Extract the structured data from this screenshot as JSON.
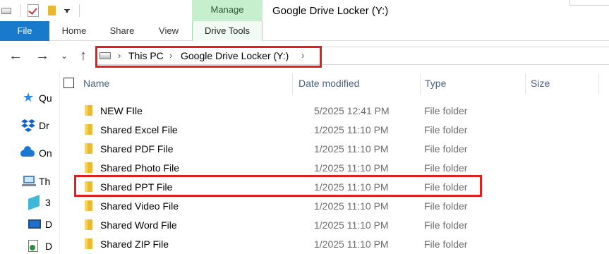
{
  "window": {
    "title": "Google Drive Locker (Y:)",
    "contextual_tab_group": "Manage"
  },
  "ribbon": {
    "tabs": [
      "File",
      "Home",
      "Share",
      "View",
      "Drive Tools"
    ]
  },
  "address": {
    "segments": [
      "This PC",
      "Google Drive Locker (Y:)"
    ]
  },
  "nav_pane": {
    "items": [
      {
        "label": "Qu",
        "icon": "star-icon"
      },
      {
        "label": "Dr",
        "icon": "dropbox-icon"
      },
      {
        "label": "On",
        "icon": "onedrive-icon"
      },
      {
        "label": "Th",
        "icon": "this-pc-icon"
      },
      {
        "label": "3",
        "icon": "3d-objects-icon"
      },
      {
        "label": "D",
        "icon": "desktop-icon"
      },
      {
        "label": "D",
        "icon": "documents-icon"
      }
    ]
  },
  "columns": {
    "name": "Name",
    "date": "Date modified",
    "type": "Type",
    "size": "Size"
  },
  "files": [
    {
      "name": "NEW FIle",
      "date": "5/2025 12:41 PM",
      "type": "File folder"
    },
    {
      "name": "Shared Excel File",
      "date": "1/2025 11:10 PM",
      "type": "File folder"
    },
    {
      "name": "Shared PDF File",
      "date": "1/2025 11:10 PM",
      "type": "File folder"
    },
    {
      "name": "Shared Photo File",
      "date": "1/2025 11:10 PM",
      "type": "File folder"
    },
    {
      "name": "Shared PPT File",
      "date": "1/2025 11:10 PM",
      "type": "File folder"
    },
    {
      "name": "Shared Video File",
      "date": "1/2025 11:10 PM",
      "type": "File folder"
    },
    {
      "name": "Shared Word File",
      "date": "1/2025 11:10 PM",
      "type": "File folder"
    },
    {
      "name": "Shared ZIP File",
      "date": "1/2025 11:10 PM",
      "type": "File folder"
    }
  ],
  "colors": {
    "file_tab": "#1979ca",
    "manage_tab": "#c6efce",
    "highlight": "#e0201f",
    "folder": "#e9bb2f"
  }
}
